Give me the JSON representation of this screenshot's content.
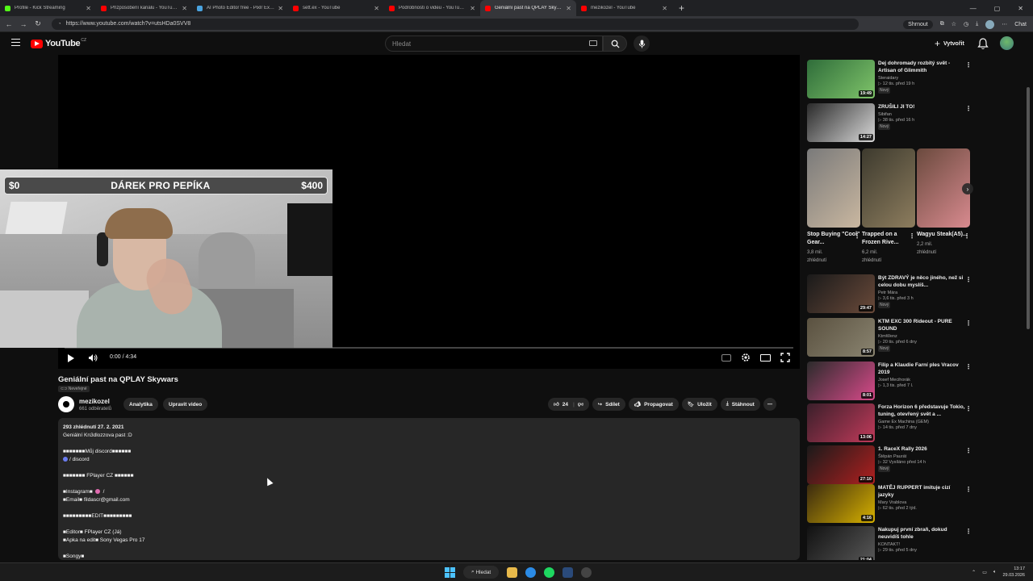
{
  "browser": {
    "tabs": [
      {
        "label": "Profile - Kick Streaming",
        "color": "#53fc18",
        "active": false
      },
      {
        "label": "Přizpůsobení kanálu - YouTube Studio",
        "color": "#ff0000",
        "active": false
      },
      {
        "label": "AI Photo Editor free - Pixlr Express",
        "color": "#4aa3df",
        "active": false
      },
      {
        "label": "sett.ex - YouTube",
        "color": "#ff0000",
        "active": false
      },
      {
        "label": "Podrobnosti o videu - YouTube Studio",
        "color": "#ff0000",
        "active": false
      },
      {
        "label": "Geniální past na QPLAY Skywars - YouTube",
        "color": "#ff0000",
        "active": true
      },
      {
        "label": "mezikozel - YouTube",
        "color": "#ff0000",
        "active": false
      }
    ],
    "url": "https://www.youtube.com/watch?v=utsHDa0SVV8",
    "toolbar": {
      "shrink_label": "Shrnout",
      "chat_label": "Chat"
    }
  },
  "header": {
    "logo_text": "YouTube",
    "region": "CZ",
    "search_placeholder": "Hledat",
    "create_label": "Vytvořit"
  },
  "player": {
    "overlay": {
      "left_amount": "$0",
      "title": "DÁREK PRO PEPÍKA",
      "right_amount": "$400"
    },
    "time": "0:00 / 4:34",
    "progress": 0
  },
  "video": {
    "title": "Geniální past na QPLAY Skywars",
    "visibility": "Neveřejné",
    "channel": "mezikozel",
    "subscribers": "661 odběratelů",
    "analytics_label": "Analytika",
    "edit_label": "Upravit video",
    "likes": "24",
    "share_label": "Sdílet",
    "promote_label": "Propagovat",
    "save_label": "Uložit",
    "download_label": "Stáhnout"
  },
  "description": {
    "meta": "293 zhlédnutí  27. 2. 2021",
    "lines": [
      "Geniální Kn3dlozzova past :D",
      "",
      "■■■■■■■Můj discord■■■■■■",
      "/ discord",
      "",
      "■■■■■■■ FPlayer CZ ■■■■■■",
      "",
      "■Instagram■",
      "■Email■  fildascr@gmail.com",
      "",
      "■■■■■■■■■EDIT■■■■■■■■■",
      "",
      "■Editor■   FPlayer CZ (Já)",
      "■Apka na edit■  Sony Vegas Pro 17",
      "",
      "■Songy■"
    ]
  },
  "sidebar": {
    "recs_top": [
      {
        "title": "Dej dohromady rozbitý svět - Artisan of Glimmith",
        "channel": "Steraidary",
        "views": "▷ 12 tis.  před 19 h",
        "badge": "Nový",
        "duration": "19:49",
        "colors": [
          "#2f6d3a",
          "#7fc46a"
        ]
      },
      {
        "title": "ZRUŠILI JI TO!",
        "channel": "Sibifan",
        "views": "▷ 38 tis.  před 16 h",
        "badge": "Nový",
        "duration": "14:27",
        "colors": [
          "#2a2a2a",
          "#d9d9d9"
        ]
      }
    ],
    "shorts": [
      {
        "title": "Stop Buying \"Cool\" Gear...",
        "views": "3,8 mil.",
        "views2": "zhlédnutí",
        "colors": [
          "#7a7a7a",
          "#c9b7a0"
        ]
      },
      {
        "title": "Trapped on a Frozen Rive...",
        "views": "6,2 mil.",
        "views2": "zhlédnutí",
        "colors": [
          "#3d3a2e",
          "#8d7d5e"
        ]
      },
      {
        "title": "Wagyu Steak(A5)...",
        "views": "2,2 mil.",
        "views2": "zhlédnutí",
        "colors": [
          "#6b4a3e",
          "#d88a8f"
        ]
      }
    ],
    "recs": [
      {
        "title": "Být ZDRAVÝ je něco jiného, než si celou dobu myslíš...",
        "channel": "Petr Mára",
        "views": "▷ 3,6 tis.  před 3 h",
        "badge": "Nový",
        "duration": "29:47",
        "colors": [
          "#1a1a1a",
          "#6a4a3a"
        ]
      },
      {
        "title": "KTM EXC 300 Rideout - PURE SOUND",
        "channel": "KtmWenz",
        "views": "▷ 20 tis.  před 6 dny",
        "badge": "Nový",
        "duration": "8:57",
        "colors": [
          "#5a5140",
          "#8a8470"
        ]
      },
      {
        "title": "Filip a Klaudie Farní ples Vracov 2019",
        "channel": "Josef Mecihorák",
        "views": "▷ 1,3 tis.  před 7 l.",
        "badge": "",
        "duration": "8:01",
        "colors": [
          "#2b2b2b",
          "#d84a8a"
        ]
      },
      {
        "title": "Forza Horizon 6 představuje Tokio, tuning, otevřený svět a ...",
        "channel": "Game Ex Machina (GEM)",
        "views": "▷ 14 tis.  před 7 dny",
        "badge": "",
        "duration": "13:06",
        "colors": [
          "#3a1f2a",
          "#c03a5a"
        ]
      },
      {
        "title": "1. RaceX Rally 2026",
        "channel": "Štěpán Paurát",
        "views": "▷ 32  Vysíláno před 14 h",
        "badge": "Nový",
        "duration": "27:10",
        "colors": [
          "#1a1a1a",
          "#b02020"
        ]
      },
      {
        "title": "MATĚJ RUPPERT  imituje cizí jazyky",
        "channel": "Mary Vrablova",
        "views": "▷ 62 tis.  před 2 týd.",
        "badge": "",
        "duration": "4:16",
        "colors": [
          "#3a2a10",
          "#d6b000"
        ]
      },
      {
        "title": "Nakupuj první zbraň, dokud neuvidíš tohle",
        "channel": "KONTAKT!",
        "views": "▷ 29 tis.  před 5 dny",
        "badge": "",
        "duration": "21:04",
        "colors": [
          "#111111",
          "#5a5a5a"
        ]
      }
    ]
  },
  "taskbar": {
    "search_label": "Hledat",
    "time": "13:17",
    "date": "29.03.2026"
  }
}
